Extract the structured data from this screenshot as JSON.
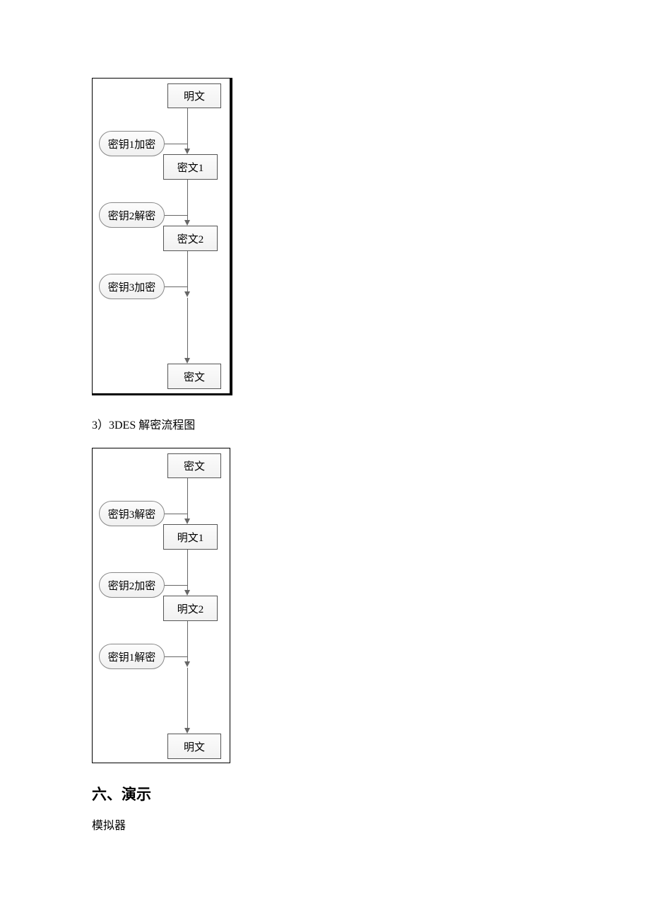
{
  "encryption_flowchart": {
    "top_node": "明文",
    "key1": "密钥1加密",
    "mid1": "密文1",
    "key2": "密钥2解密",
    "mid2": "密文2",
    "key3": "密钥3加密",
    "bottom_node": "密文"
  },
  "caption_1": "3）3DES 解密流程图",
  "decryption_flowchart": {
    "top_node": "密文",
    "key1": "密钥3解密",
    "mid1": "明文1",
    "key2": "密钥2加密",
    "mid2": "明文2",
    "key3": "密钥1解密",
    "bottom_node": "明文"
  },
  "heading": "六、演示",
  "body_text": "模拟器"
}
